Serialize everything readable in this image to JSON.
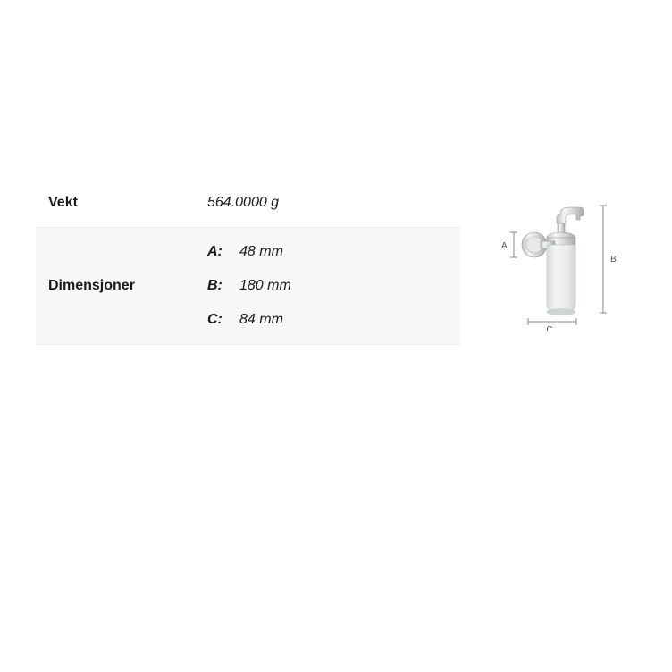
{
  "specs": {
    "weight": {
      "label": "Vekt",
      "value": "564.0000 g"
    },
    "dimensions": {
      "label": "Dimensjoner",
      "items": [
        {
          "key": "A:",
          "value": "48 mm"
        },
        {
          "key": "B:",
          "value": "180 mm"
        },
        {
          "key": "C:",
          "value": "84 mm"
        }
      ]
    }
  },
  "diagram": {
    "labelA": "A",
    "labelB": "B",
    "labelC": "C"
  }
}
